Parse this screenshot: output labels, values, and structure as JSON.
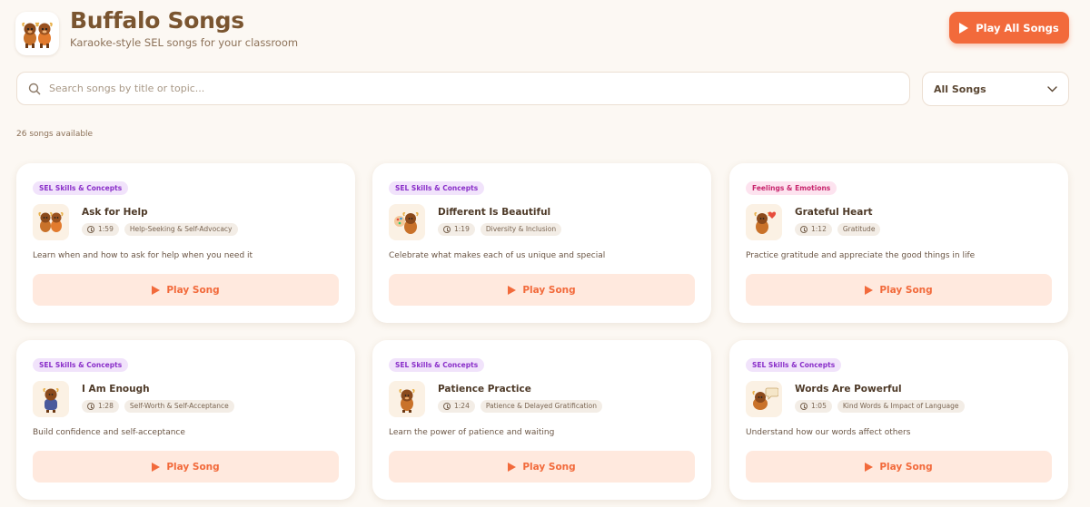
{
  "app": {
    "title": "Buffalo Songs",
    "subtitle": "Karaoke-style SEL songs for your classroom",
    "play_all_label": "Play All Songs",
    "accent_color": "#f26a3b"
  },
  "search": {
    "placeholder": "Search songs by title or topic...",
    "value": ""
  },
  "filter": {
    "selected": "All Songs"
  },
  "songs_count_text": "26 songs available",
  "songs": [
    {
      "category": "SEL Skills & Concepts",
      "category_kind": "sel",
      "title": "Ask for Help",
      "duration": "1:59",
      "topic": "Help-Seeking & Self-Advocacy",
      "description": "Learn when and how to ask for help when you need it",
      "play_label": "Play Song"
    },
    {
      "category": "SEL Skills & Concepts",
      "category_kind": "sel",
      "title": "Different Is Beautiful",
      "duration": "1:19",
      "topic": "Diversity & Inclusion",
      "description": "Celebrate what makes each of us unique and special",
      "play_label": "Play Song"
    },
    {
      "category": "Feelings & Emotions",
      "category_kind": "feelings",
      "title": "Grateful Heart",
      "duration": "1:12",
      "topic": "Gratitude",
      "description": "Practice gratitude and appreciate the good things in life",
      "play_label": "Play Song"
    },
    {
      "category": "SEL Skills & Concepts",
      "category_kind": "sel",
      "title": "I Am Enough",
      "duration": "1:28",
      "topic": "Self-Worth & Self-Acceptance",
      "description": "Build confidence and self-acceptance",
      "play_label": "Play Song"
    },
    {
      "category": "SEL Skills & Concepts",
      "category_kind": "sel",
      "title": "Patience Practice",
      "duration": "1:24",
      "topic": "Patience & Delayed Gratification",
      "description": "Learn the power of patience and waiting",
      "play_label": "Play Song"
    },
    {
      "category": "SEL Skills & Concepts",
      "category_kind": "sel",
      "title": "Words Are Powerful",
      "duration": "1:05",
      "topic": "Kind Words & Impact of Language",
      "description": "Understand how our words affect others",
      "play_label": "Play Song"
    }
  ],
  "tag_colors": {
    "sel": {
      "bg": "#f1e3fb",
      "fg": "#8a2fc9"
    },
    "feelings": {
      "bg": "#fde3ef",
      "fg": "#c8266e"
    }
  }
}
